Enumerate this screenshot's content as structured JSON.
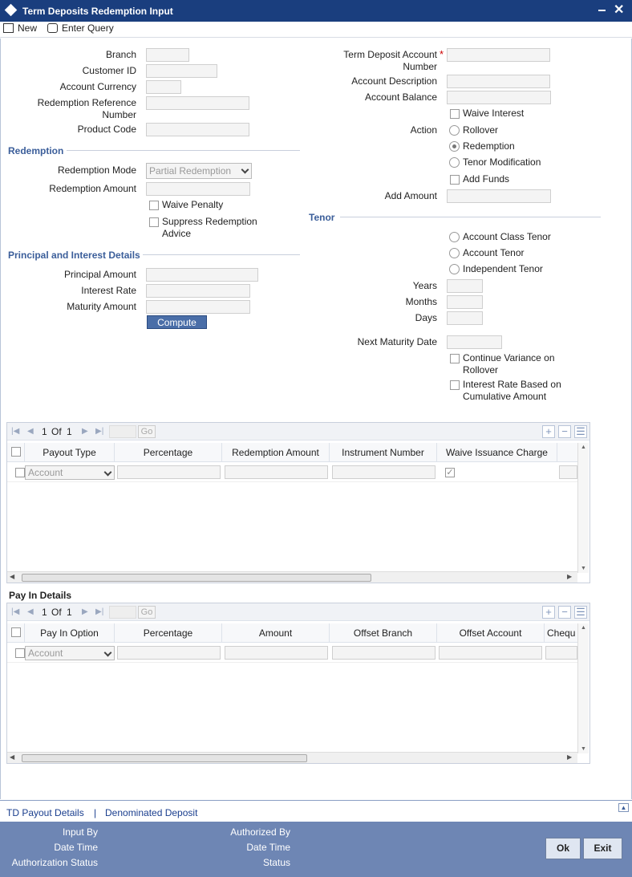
{
  "window": {
    "title": "Term Deposits Redemption Input"
  },
  "toolbar": {
    "new_label": "New",
    "enter_query_label": "Enter Query"
  },
  "form": {
    "branch_label": "Branch",
    "customer_id_label": "Customer ID",
    "account_currency_label": "Account Currency",
    "redemption_ref_label_1": "Redemption Reference",
    "redemption_ref_label_2": "Number",
    "product_code_label": "Product Code",
    "td_account_label_1": "Term Deposit Account",
    "td_account_label_2": "Number",
    "required_mark": "*",
    "account_description_label": "Account Description",
    "account_balance_label": "Account Balance",
    "waive_interest_label": "Waive Interest",
    "action_label": "Action",
    "action_options": [
      "Rollover",
      "Redemption",
      "Tenor Modification"
    ],
    "action_selected": "Redemption",
    "add_funds_label": "Add Funds",
    "add_amount_label": "Add Amount"
  },
  "redemption": {
    "section_title": "Redemption",
    "mode_label": "Redemption Mode",
    "mode_value": "Partial Redemption",
    "amount_label": "Redemption Amount",
    "waive_penalty_label": "Waive Penalty",
    "suppress_label_1": "Suppress Redemption",
    "suppress_label_2": "Advice"
  },
  "principal": {
    "section_title": "Principal and Interest Details",
    "principal_amount_label": "Principal Amount",
    "interest_rate_label": "Interest Rate",
    "maturity_amount_label": "Maturity Amount",
    "compute_label": "Compute"
  },
  "tenor": {
    "section_title": "Tenor",
    "options": [
      "Account Class Tenor",
      "Account Tenor",
      "Independent Tenor"
    ],
    "years_label": "Years",
    "months_label": "Months",
    "days_label": "Days",
    "next_maturity_label": "Next Maturity Date",
    "continue_variance_1": "Continue Variance on",
    "continue_variance_2": "Rollover",
    "interest_rate_based_1": "Interest Rate Based on",
    "interest_rate_based_2": "Cumulative Amount"
  },
  "payout_grid": {
    "page_current": "1",
    "page_of": "Of",
    "page_total": "1",
    "go_label": "Go",
    "columns": [
      "Payout Type",
      "Percentage",
      "Redemption Amount",
      "Instrument Number",
      "Waive Issuance Charge"
    ],
    "row_type_value": "Account",
    "row_waive_checked": true
  },
  "payin": {
    "section_title": "Pay In Details",
    "page_current": "1",
    "page_of": "Of",
    "page_total": "1",
    "go_label": "Go",
    "columns": [
      "Pay In Option",
      "Percentage",
      "Amount",
      "Offset Branch",
      "Offset Account",
      "Chequ"
    ],
    "row_option_value": "Account"
  },
  "links": {
    "td_payout": "TD Payout Details",
    "separator": "|",
    "denominated": "Denominated Deposit"
  },
  "footer": {
    "input_by": "Input By",
    "date_time": "Date Time",
    "auth_status": "Authorization Status",
    "authorized_by": "Authorized By",
    "date_time_2": "Date Time",
    "status": "Status",
    "ok_label": "Ok",
    "exit_label": "Exit"
  },
  "colors": {
    "titlebar": "#1a3e7e",
    "section": "#3b5e9a",
    "footer": "#6e86b4",
    "button": "#4a6ea8"
  }
}
